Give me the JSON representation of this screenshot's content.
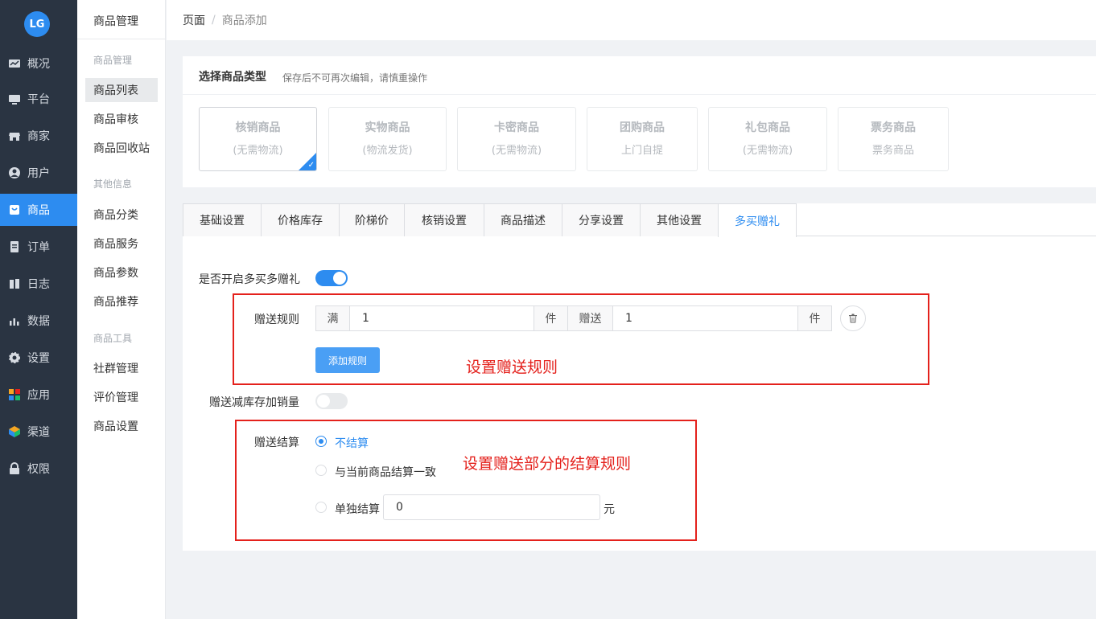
{
  "nav": {
    "logo_text": "LG",
    "items": [
      {
        "label": "概况",
        "icon": "dashboard-icon"
      },
      {
        "label": "平台",
        "icon": "monitor-icon"
      },
      {
        "label": "商家",
        "icon": "store-icon"
      },
      {
        "label": "用户",
        "icon": "user-icon"
      },
      {
        "label": "商品",
        "icon": "goods-icon",
        "active": true
      },
      {
        "label": "订单",
        "icon": "order-icon"
      },
      {
        "label": "日志",
        "icon": "log-icon"
      },
      {
        "label": "数据",
        "icon": "chart-icon"
      },
      {
        "label": "设置",
        "icon": "gear-icon"
      },
      {
        "label": "应用",
        "icon": "apps-icon"
      },
      {
        "label": "渠道",
        "icon": "cube-icon"
      },
      {
        "label": "权限",
        "icon": "lock-icon"
      }
    ]
  },
  "subnav": {
    "title": "商品管理",
    "groups": [
      {
        "title": "商品管理",
        "items": [
          "商品列表",
          "商品审核",
          "商品回收站"
        ]
      },
      {
        "title": "其他信息",
        "items": [
          "商品分类",
          "商品服务",
          "商品参数",
          "商品推荐"
        ]
      },
      {
        "title": "商品工具",
        "items": [
          "社群管理",
          "评价管理",
          "商品设置"
        ]
      }
    ],
    "active_item": "商品列表"
  },
  "breadcrumb": {
    "root": "页面",
    "separator": "/",
    "current": "商品添加"
  },
  "type_section": {
    "title": "选择商品类型",
    "tip": "保存后不可再次编辑，请慎重操作",
    "types": [
      {
        "name": "核销商品",
        "sub": "(无需物流)",
        "selected": true
      },
      {
        "name": "实物商品",
        "sub": "(物流发货)"
      },
      {
        "name": "卡密商品",
        "sub": "(无需物流)"
      },
      {
        "name": "团购商品",
        "sub": "上门自提"
      },
      {
        "name": "礼包商品",
        "sub": "(无需物流)"
      },
      {
        "name": "票务商品",
        "sub": "票务商品"
      }
    ]
  },
  "tabs": [
    "基础设置",
    "价格库存",
    "阶梯价",
    "核销设置",
    "商品描述",
    "分享设置",
    "其他设置",
    "多买赠礼"
  ],
  "active_tab": "多买赠礼",
  "form": {
    "enable_label": "是否开启多买多赠礼",
    "enable_on": true,
    "rule_label": "赠送规则",
    "rule_full_prefix": "满",
    "rule_full_value": "1",
    "rule_unit": "件",
    "rule_gift_prefix": "赠送",
    "rule_gift_value": "1",
    "rule_gift_unit": "件",
    "add_rule_button": "添加规则",
    "reduce_stock_label": "赠送减库存加销量",
    "reduce_stock_on": false,
    "settle_label": "赠送结算",
    "settle_options": [
      {
        "label": "不结算",
        "checked": true
      },
      {
        "label": "与当前商品结算一致",
        "checked": false
      },
      {
        "label": "单独结算",
        "checked": false
      }
    ],
    "settle_value": "0",
    "settle_unit": "元"
  },
  "annotations": {
    "rule_note": "设置赠送规则",
    "settle_note": "设置赠送部分的结算规则"
  },
  "colors": {
    "accent": "#2d8cf0",
    "nav_bg": "#2a3442",
    "annotation": "#e4211c"
  }
}
